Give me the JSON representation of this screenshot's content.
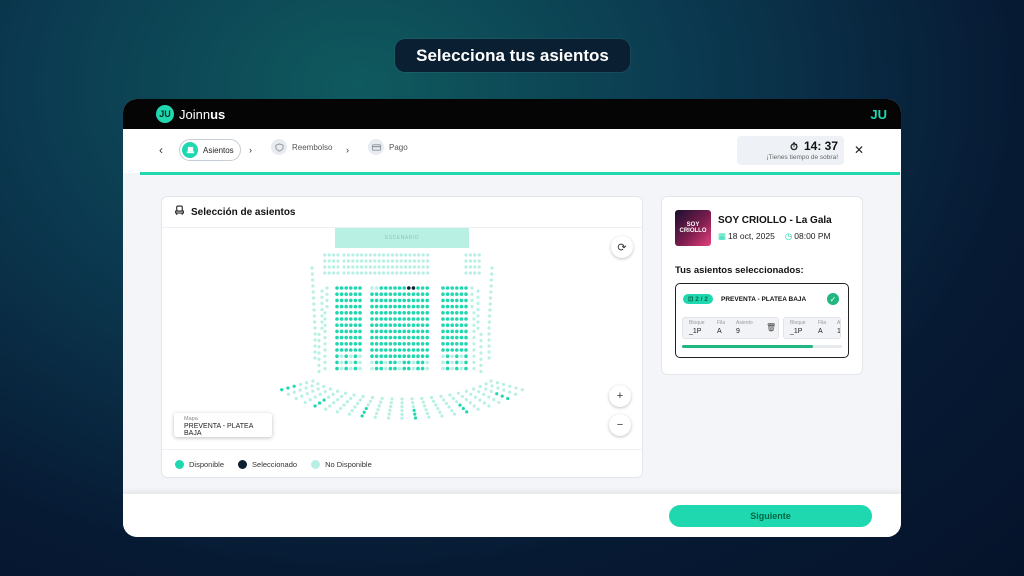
{
  "hero": {
    "title": "Selecciona tus asientos"
  },
  "brand": {
    "name_prefix": "Joinn",
    "name_suffix": "us",
    "badge": "JU",
    "mark": "JU"
  },
  "steps": [
    {
      "label": "Asientos",
      "icon": "seat-icon"
    },
    {
      "label": "Reembolso",
      "icon": "shield-icon"
    },
    {
      "label": "Pago",
      "icon": "card-icon"
    }
  ],
  "timer": {
    "time": "14: 37",
    "subtitle": "¡Tienes tiempo de sobra!"
  },
  "map": {
    "title": "Selección de asientos",
    "stage_label": "ESCENARIO",
    "map_label_small": "Mapa",
    "map_label_main": "PREVENTA - PLATEA BAJA",
    "zoom_in": "+",
    "zoom_out": "−",
    "refresh": "⟳"
  },
  "legend": [
    {
      "label": "Disponible",
      "color": "#1fd8b0"
    },
    {
      "label": "Seleccionado",
      "color": "#0b1f33"
    },
    {
      "label": "No Disponible",
      "color": "#b8f0e4"
    }
  ],
  "event": {
    "image_text": "SOY CRIOLLO",
    "title": "SOY CRIOLLO - La Gala",
    "date": "18 oct, 2025",
    "time": "08:00 PM"
  },
  "selection": {
    "title": "Tus asientos seleccionados:",
    "badge": "2 / 2",
    "zone": "PREVENTA - PLATEA BAJA",
    "progress": 0.82,
    "seats": [
      {
        "bloque_label": "Bloque",
        "bloque": "_1P",
        "fila_label": "Fila",
        "fila": "A",
        "asiento_label": "Asiento",
        "asiento": "9"
      },
      {
        "bloque_label": "Bloque",
        "bloque": "_1P",
        "fila_label": "Fila",
        "fila": "A",
        "asiento_label": "A",
        "asiento": "1"
      }
    ]
  },
  "footer": {
    "next_label": "Siguiente"
  },
  "colors": {
    "accent": "#1fd8b0",
    "selected": "#0b1f33",
    "unavailable": "#b8f0e4"
  }
}
